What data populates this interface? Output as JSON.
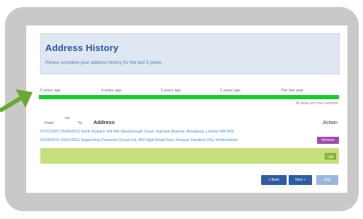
{
  "page": {
    "title": "Address History",
    "subtitle": "Please complete your address history for the last 5 years."
  },
  "timeline": {
    "labels": [
      "5 years ago",
      "4 years ago",
      "3 years ago",
      "2 years ago",
      "The last year"
    ],
    "progress": 1.0,
    "progress_color": "#22c43a",
    "note": "All dates are now complete"
  },
  "table": {
    "col_from": "From",
    "col_from_sub": "Yes",
    "col_to": "To",
    "col_address": "Address",
    "col_action": "Action",
    "rows": [
      {
        "text": "07/01/2007 05/09/2011 North Dulwich Hill 496 Stanborough Court, Garrison Avenue, Broadway, London W8 8KE"
      },
      {
        "text": "01/08/2011 01/01/2011 Supporting Character Group Ltd, 860 High Road East, Sonquin Gardens City, Hertfordshire"
      }
    ],
    "remove_label": "Remove",
    "add_label": "Add"
  },
  "nav": {
    "back_label": "< Back",
    "next_label": "Next >",
    "skip_label": "Skip"
  },
  "colors": {
    "frame": "#c9c9c9",
    "title": "#27579c",
    "header_bg": "#dfe7f2",
    "row_link": "#3f8fcf",
    "remove_button": "#9a4ea8",
    "green_bar": "#c5de7e",
    "nav_button": "#2f5d9e",
    "arrow": "#6aa832"
  },
  "icons": {
    "pointer": "arrow-right-icon"
  }
}
